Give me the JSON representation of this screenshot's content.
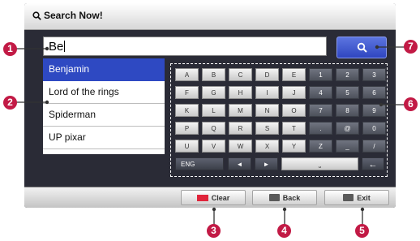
{
  "header": {
    "title": "Search Now!",
    "icon": "search-icon"
  },
  "search": {
    "value": "Be"
  },
  "search_button": {
    "icon": "search-icon"
  },
  "results": [
    "Benjamin",
    "Lord of the rings",
    "Spiderman",
    "UP pixar"
  ],
  "keyboard": {
    "rows": [
      [
        "A",
        "B",
        "C",
        "D",
        "E",
        "1",
        "2",
        "3"
      ],
      [
        "F",
        "G",
        "H",
        "I",
        "J",
        "4",
        "5",
        "6"
      ],
      [
        "K",
        "L",
        "M",
        "N",
        "O",
        "7",
        "8",
        "9"
      ],
      [
        "P",
        "Q",
        "R",
        "S",
        "T",
        ".",
        "@",
        "0"
      ],
      [
        "U",
        "V",
        "W",
        "X",
        "Y",
        "Z",
        "_",
        "/"
      ]
    ],
    "lang_label": "ENG",
    "left_arrow": "◄",
    "right_arrow": "►",
    "space_glyph": "⎵",
    "backspace_glyph": "←"
  },
  "footer": {
    "clear": {
      "label": "Clear",
      "color": "#e0243a"
    },
    "back": {
      "label": "Back"
    },
    "exit": {
      "label": "Exit"
    }
  },
  "callouts": [
    "1",
    "2",
    "3",
    "4",
    "5",
    "6",
    "7"
  ],
  "colors": {
    "accent": "#2e49c2",
    "callout": "#c21a45"
  }
}
